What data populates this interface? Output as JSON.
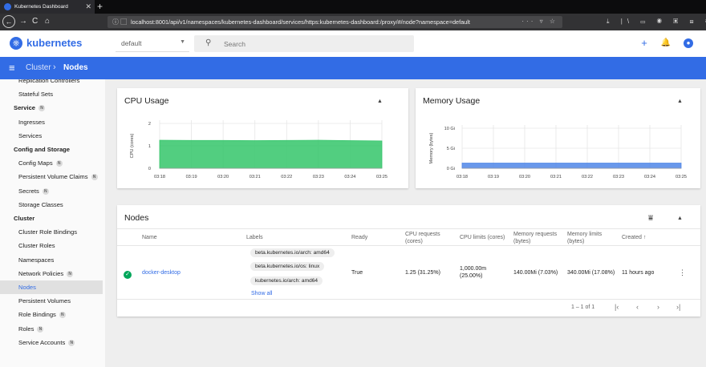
{
  "browser": {
    "tab_title": "Kubernetes Dashboard",
    "tab_close": "✕",
    "new_tab": "+",
    "url": "localhost:8001/api/v1/namespaces/kubernetes-dashboard/services/https:kubernetes-dashboard:/proxy/#/node?namespace=default",
    "back": "←",
    "forward": "→",
    "reload": "C",
    "home": "⌂",
    "url_info": "ⓘ ▢",
    "url_icons": "··· ▿ ☆",
    "toolbar_icons": "⤓ |\\ ▭ ◉ ▣ ⊞ ≡"
  },
  "app": {
    "brand": "kubernetes",
    "namespace": "default",
    "search_placeholder": "Search",
    "add": "+",
    "bell": "🔔",
    "account": "●"
  },
  "toolbar": {
    "menu": "≡",
    "parent": "Cluster",
    "separator": "›",
    "current": "Nodes"
  },
  "sidebar": {
    "items": [
      {
        "label": "Replication Controllers",
        "type": "item"
      },
      {
        "label": "Stateful Sets",
        "type": "item"
      },
      {
        "label": "Service",
        "type": "section",
        "badge": "N"
      },
      {
        "label": "Ingresses",
        "type": "item"
      },
      {
        "label": "Services",
        "type": "item"
      },
      {
        "label": "Config and Storage",
        "type": "section"
      },
      {
        "label": "Config Maps",
        "type": "item",
        "badge": "N"
      },
      {
        "label": "Persistent Volume Claims",
        "type": "item",
        "badge": "N"
      },
      {
        "label": "Secrets",
        "type": "item",
        "badge": "N"
      },
      {
        "label": "Storage Classes",
        "type": "item"
      },
      {
        "label": "Cluster",
        "type": "section"
      },
      {
        "label": "Cluster Role Bindings",
        "type": "item"
      },
      {
        "label": "Cluster Roles",
        "type": "item"
      },
      {
        "label": "Namespaces",
        "type": "item"
      },
      {
        "label": "Network Policies",
        "type": "item",
        "badge": "N"
      },
      {
        "label": "Nodes",
        "type": "item",
        "active": true
      },
      {
        "label": "Persistent Volumes",
        "type": "item"
      },
      {
        "label": "Role Bindings",
        "type": "item",
        "badge": "N"
      },
      {
        "label": "Roles",
        "type": "item",
        "badge": "N"
      },
      {
        "label": "Service Accounts",
        "type": "item",
        "badge": "N"
      }
    ]
  },
  "cpu_card": {
    "title": "CPU Usage",
    "collapse": "▲"
  },
  "mem_card": {
    "title": "Memory Usage",
    "collapse": "▲"
  },
  "chart_data": [
    {
      "type": "area",
      "title": "CPU Usage",
      "ylabel": "CPU (cores)",
      "x": [
        "03:18",
        "03:19",
        "03:20",
        "03:21",
        "03:22",
        "03:23",
        "03:24",
        "03:25"
      ],
      "yticks": [
        "0",
        "1",
        "2"
      ],
      "ytick_values": [
        0,
        1,
        2
      ],
      "ylim": [
        0,
        2
      ],
      "series": [
        {
          "values": [
            1.25,
            1.24,
            1.24,
            1.23,
            1.24,
            1.25,
            1.23,
            1.22
          ]
        }
      ],
      "fill_color": "#34c56a",
      "grid": true
    },
    {
      "type": "area",
      "title": "Memory Usage",
      "ylabel": "Memory (bytes)",
      "x": [
        "03:18",
        "03:19",
        "03:20",
        "03:21",
        "03:22",
        "03:23",
        "03:24",
        "03:25"
      ],
      "yticks": [
        "0 Gi",
        "5 Gi",
        "10 Gi"
      ],
      "ytick_values": [
        0,
        5,
        10
      ],
      "ylim": [
        0,
        10
      ],
      "series": [
        {
          "values": [
            1.3,
            1.3,
            1.3,
            1.3,
            1.3,
            1.3,
            1.3,
            1.3
          ]
        }
      ],
      "fill_color": "#4f86e8",
      "grid": true
    }
  ],
  "nodes_card": {
    "title": "Nodes",
    "filter": "⩸",
    "collapse": "▲",
    "columns": {
      "name": "Name",
      "labels": "Labels",
      "ready": "Ready",
      "cpu_requests": "CPU requests (cores)",
      "cpu_limits": "CPU limits (cores)",
      "mem_requests": "Memory requests (bytes)",
      "mem_limits": "Memory limits (bytes)",
      "created": "Created ↑"
    },
    "row": {
      "status": "✓",
      "name": "docker-desktop",
      "labels": [
        "beta.kubernetes.io/arch: amd64",
        "beta.kubernetes.io/os: linux",
        "kubernetes.io/arch: amd64"
      ],
      "show_all": "Show all",
      "ready": "True",
      "cpu_requests": "1.25 (31.25%)",
      "cpu_limits_1": "1,000.00m",
      "cpu_limits_2": "(25.00%)",
      "mem_requests": "140.00Mi (7.03%)",
      "mem_limits": "340.00Mi (17.08%)",
      "created": "11 hours ago",
      "menu": "⋮"
    },
    "pager": {
      "range": "1 – 1 of 1",
      "first": "|‹",
      "prev": "‹",
      "next": "›",
      "last": "›|"
    }
  }
}
